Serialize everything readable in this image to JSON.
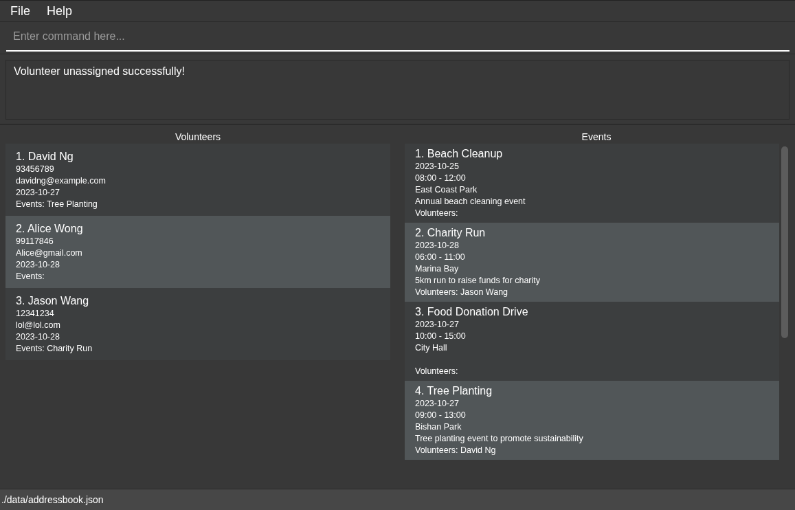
{
  "menu": [
    "File",
    "Help"
  ],
  "command_box": {
    "placeholder": "Enter command here..."
  },
  "result_display": {
    "text": "Volunteer unassigned successfully!"
  },
  "volunteers": {
    "title": "Volunteers",
    "items": [
      {
        "title": "1. David Ng",
        "phone": "93456789",
        "email": "davidng@example.com",
        "date": "2023-10-27",
        "events": "Events: Tree Planting"
      },
      {
        "title": "2. Alice Wong",
        "phone": "99117846",
        "email": "Alice@gmail.com",
        "date": "2023-10-28",
        "events": "Events:"
      },
      {
        "title": "3. Jason Wang",
        "phone": "12341234",
        "email": "lol@lol.com",
        "date": "2023-10-28",
        "events": "Events: Charity Run"
      }
    ]
  },
  "events": {
    "title": "Events",
    "items": [
      {
        "title": "1. Beach Cleanup",
        "date": "2023-10-25",
        "time": "08:00 - 12:00",
        "location": "East Coast Park",
        "description": "Annual beach cleaning event",
        "volunteers": "Volunteers:"
      },
      {
        "title": "2. Charity Run",
        "date": "2023-10-28",
        "time": "06:00 - 11:00",
        "location": "Marina Bay",
        "description": "5km run to raise funds for charity",
        "volunteers": "Volunteers: Jason Wang"
      },
      {
        "title": "3. Food Donation Drive",
        "date": "2023-10-27",
        "time": "10:00 - 15:00",
        "location": "City Hall",
        "volunteers": "Volunteers:"
      },
      {
        "title": "4. Tree Planting",
        "date": "2023-10-27",
        "time": "09:00 - 13:00",
        "location": "Bishan Park",
        "description": "Tree planting event to promote sustainability",
        "volunteers": "Volunteers: David Ng"
      }
    ]
  },
  "status_bar": {
    "path": "./data/addressbook.json"
  }
}
